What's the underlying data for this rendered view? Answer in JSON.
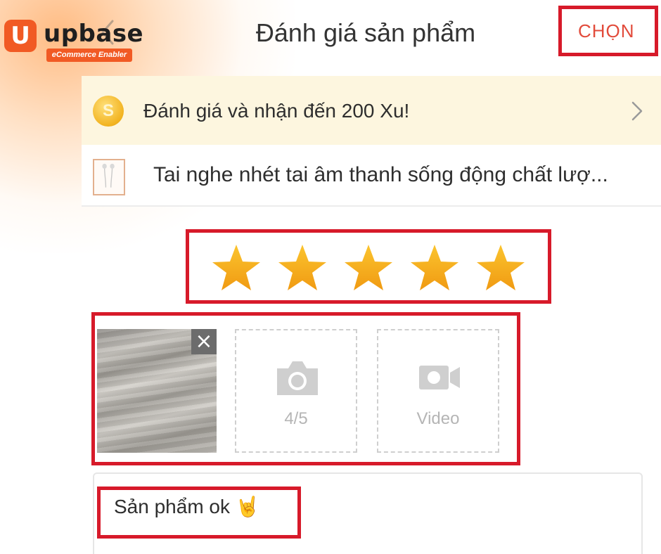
{
  "brand": {
    "logo_letter": "U",
    "name": "upbase",
    "tagline": "eCommerce Enabler",
    "accent_color": "#f15a24"
  },
  "header": {
    "title": "Đánh giá sản phẩm",
    "choose_label": "CHỌN",
    "back_icon": "back-arrow-icon"
  },
  "coin_banner": {
    "coin_letter": "S",
    "text": "Đánh giá và nhận đến 200 Xu!",
    "icon": "coin-icon"
  },
  "product": {
    "name": "Tai nghe nhét tai âm thanh sống động chất lượ..."
  },
  "rating": {
    "stars_filled": 5,
    "stars_total": 5,
    "star_color": "#f5b21c"
  },
  "media": {
    "remove_label": "×",
    "photo_count_label": "4/5",
    "video_label": "Video"
  },
  "review": {
    "text": "Sản phẩm ok 🤘"
  },
  "highlight_color": "#d71a2a"
}
